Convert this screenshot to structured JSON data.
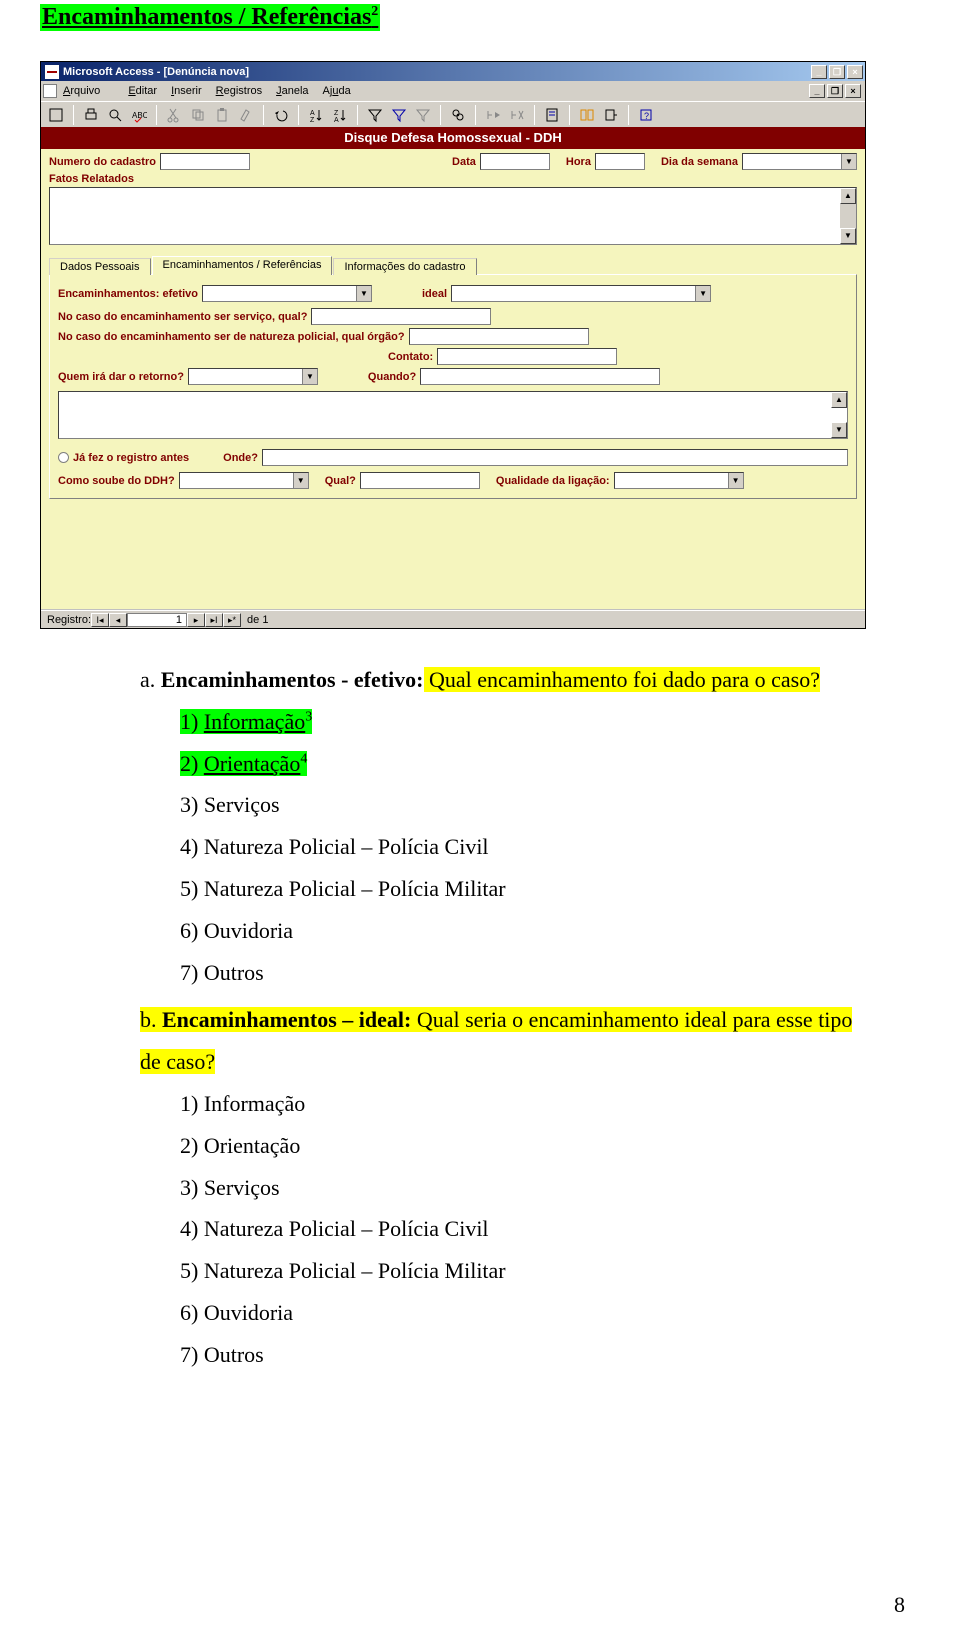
{
  "heading": "Encaminhamentos / Referências",
  "heading_sup": "2",
  "screenshot": {
    "title": "Microsoft Access - [Denúncia nova]",
    "menu": {
      "arquivo": "Arquivo",
      "editar": "Editar",
      "inserir": "Inserir",
      "registros": "Registros",
      "janela": "Janela",
      "ajuda": "Ajuda"
    },
    "app_title": "Disque Defesa Homossexual - DDH",
    "header_fields": {
      "numero_cadastro": "Numero do cadastro",
      "data": "Data",
      "hora": "Hora",
      "dia_semana": "Dia da semana"
    },
    "fatos_label": "Fatos Relatados",
    "tabs": {
      "t1": "Dados Pessoais",
      "t2": "Encaminhamentos / Referências",
      "t3": "Informações do cadastro"
    },
    "form": {
      "efetivo_label": "Encaminhamentos: efetivo",
      "ideal_label": "ideal",
      "servico_label": "No caso do encaminhamento ser serviço, qual?",
      "policial_label": "No caso do encaminhamento ser de natureza policial, qual órgão?",
      "contato_label": "Contato:",
      "retorno_label": "Quem irá dar o retorno?",
      "quando_label": "Quando?",
      "ja_fez_label": "Já fez o registro antes",
      "onde_label": "Onde?",
      "como_soube_label": "Como soube do DDH?",
      "qual_label": "Qual?",
      "qualidade_label": "Qualidade da ligação:"
    },
    "nav": {
      "registro": "Registro:",
      "pos": "1",
      "de": "de 1"
    }
  },
  "content": {
    "a_prefix": "a. ",
    "a_bold": "Encaminhamentos - efetivo:",
    "a_rest": " Qual encaminhamento foi dado para o caso?",
    "list1": {
      "i1_pre": "1) ",
      "i1": "Informação",
      "i1_sup": "3",
      "i2_pre": "2) ",
      "i2": "Orientação",
      "i2_sup": "4",
      "i3": "3) Serviços",
      "i4": "4) Natureza Policial – Polícia Civil",
      "i5": "5) Natureza Policial – Polícia Militar",
      "i6": "6) Ouvidoria",
      "i7": "7) Outros"
    },
    "b_prefix": "b. ",
    "b_bold": "Encaminhamentos – ideal:",
    "b_rest": " Qual seria o encaminhamento ideal para esse tipo",
    "b_rest2": "de caso?",
    "list2": {
      "i1": "1) Informação",
      "i2": "2) Orientação",
      "i3": "3) Serviços",
      "i4": "4) Natureza Policial – Polícia Civil",
      "i5": "5) Natureza Policial – Polícia Militar",
      "i6": "6) Ouvidoria",
      "i7": "7) Outros"
    }
  },
  "page_number": "8"
}
